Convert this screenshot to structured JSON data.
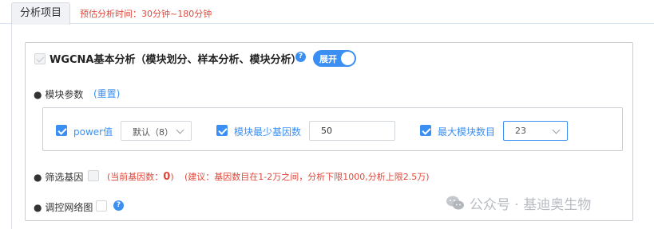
{
  "tabs": [
    {
      "label": "分析项目"
    }
  ],
  "estimate_note": "预估分析时间：30分钟~180分钟",
  "module": {
    "title": "WGCNA基本分析（模块划分、样本分析、模块分析）",
    "help_glyph": "?",
    "toggle_label": "展开",
    "toggle_on": true
  },
  "params_section": {
    "label": "模块参数",
    "reset_link": "(重置)",
    "power": {
      "label": "power值",
      "value": "默认（8）",
      "checked": true
    },
    "min_genes": {
      "label": "模块最少基因数",
      "value": "50",
      "checked": true
    },
    "max_modules": {
      "label": "最大模块数目",
      "value": "23",
      "checked": true
    }
  },
  "filter_section": {
    "label": "筛选基因",
    "count_prefix": "(当前基因数：",
    "count_value": "0",
    "count_suffix": ")",
    "advice": "(建议：基因数目在1-2万之间，分析下限1000,分析上限2.5万)"
  },
  "network_section": {
    "label": "调控网络图",
    "help_glyph": "?"
  },
  "watermark": "公众号 · 基迪奥生物",
  "colors": {
    "accent": "#3b8ff3",
    "warning": "#e0473a",
    "border": "#c9ccd1"
  },
  "icons": {
    "bullet": "●",
    "wechat": "wechat-icon"
  }
}
